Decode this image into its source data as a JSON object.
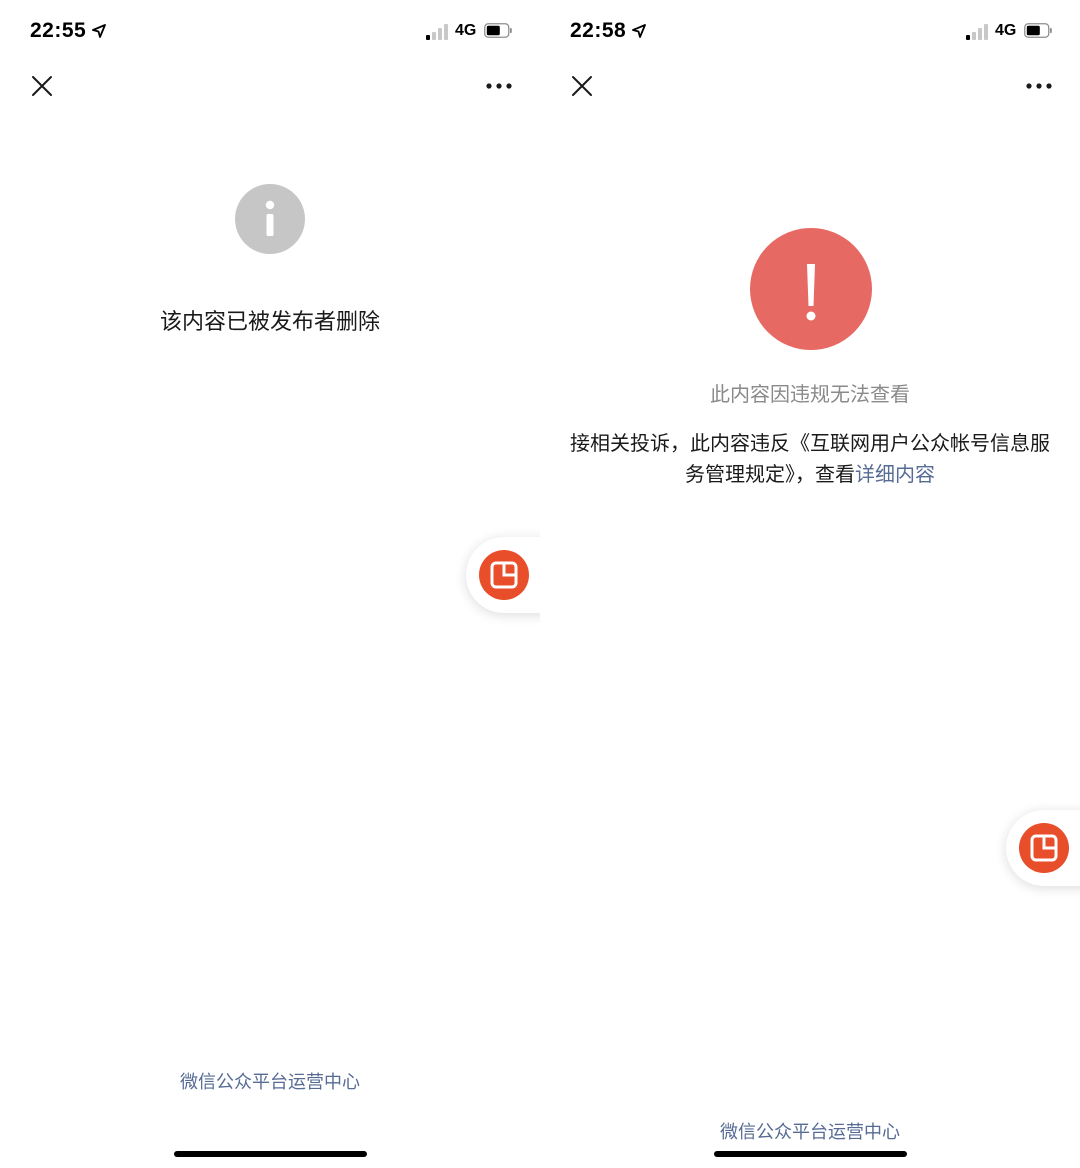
{
  "left_screen": {
    "status_bar": {
      "time": "22:55",
      "network": "4G"
    },
    "message": "该内容已被发布者删除",
    "footer_link": "微信公众平台运营中心"
  },
  "right_screen": {
    "status_bar": {
      "time": "22:58",
      "network": "4G"
    },
    "title": "此内容因违规无法查看",
    "body_text": "接相关投诉，此内容违反《互联网用户公众帐号信息服务管理规定》，查看",
    "detail_link": "详细内容",
    "footer_link": "微信公众平台运营中心"
  },
  "icons": {
    "close": "close-icon",
    "more": "more-icon",
    "info": "info-icon",
    "alert": "exclamation-icon",
    "float": "floating-window-icon"
  },
  "colors": {
    "link": "#576b95",
    "info_gray": "#c6c6c6",
    "alert_red": "#e66a63",
    "float_orange": "#e94e2a"
  }
}
